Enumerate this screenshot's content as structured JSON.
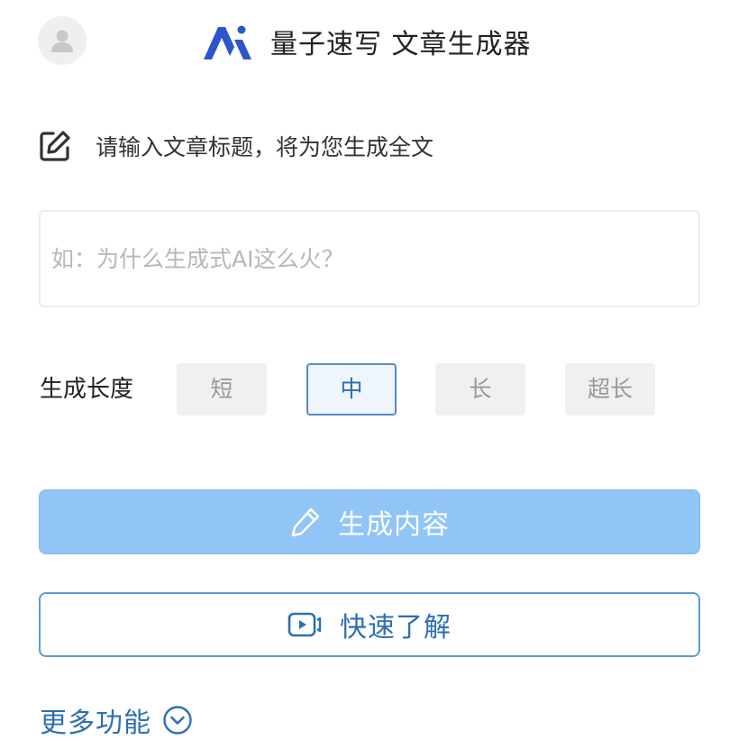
{
  "header": {
    "title": "量子速写 文章生成器",
    "avatar_icon": "user-avatar-icon",
    "logo_icon": "ai-logo-icon"
  },
  "prompt": {
    "text": "请输入文章标题，将为您生成全文",
    "icon": "edit-icon"
  },
  "title_input": {
    "value": "",
    "placeholder": "如：为什么生成式AI这么火？"
  },
  "length": {
    "label": "生成长度",
    "options": [
      "短",
      "中",
      "长",
      "超长"
    ],
    "selected": "中"
  },
  "buttons": {
    "generate_label": "生成内容",
    "generate_icon": "pencil-icon",
    "learn_label": "快速了解",
    "learn_icon": "video-play-icon"
  },
  "more": {
    "label": "更多功能",
    "icon": "chevron-down-circle-icon"
  },
  "colors": {
    "primary": "#2d6fb3",
    "generate_bg": "#91c4f7",
    "selected_border": "#5a8ac2",
    "option_bg": "#f0f0f0",
    "logo": "#2c55c9"
  }
}
